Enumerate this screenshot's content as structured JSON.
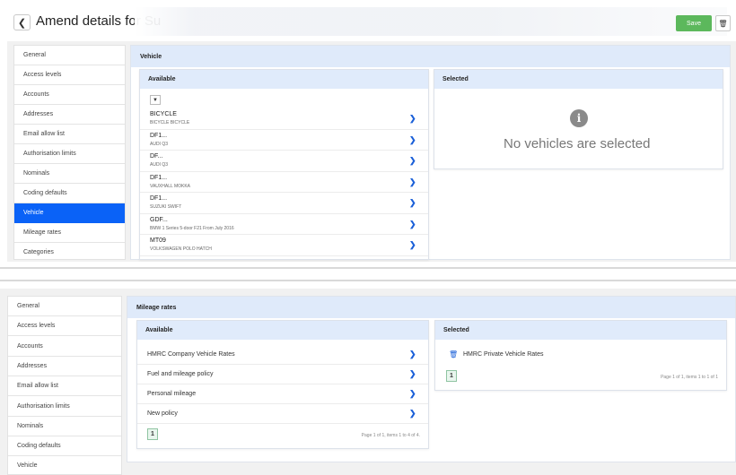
{
  "header": {
    "title": "Amend details for Su",
    "back_icon": "chevron-left-icon",
    "save_label": "Save",
    "delete_icon": "trash-icon"
  },
  "colors": {
    "active_nav": "#0a62f7",
    "save": "#5cb85c",
    "panel_header": "#dfeafa",
    "link": "#1a5fd8"
  },
  "upper": {
    "sidebar": [
      "General",
      "Access levels",
      "Accounts",
      "Addresses",
      "Email allow list",
      "Authorisation limits",
      "Nominals",
      "Coding defaults",
      "Vehicle",
      "Mileage rates",
      "Categories"
    ],
    "active_item": "Vehicle",
    "section_title": "Vehicle",
    "available_title": "Available",
    "filter_icon": "filter-icon",
    "vehicles": [
      {
        "reg": "BICYCLE",
        "desc": "BICYCLE BICYCLE"
      },
      {
        "reg": "DF1...",
        "desc": "AUDI Q3"
      },
      {
        "reg": "DF...",
        "desc": "AUDI Q3"
      },
      {
        "reg": "DF1...",
        "desc": "VAUXHALL MOKKA"
      },
      {
        "reg": "DF1...",
        "desc": "SUZUKI SWIFT"
      },
      {
        "reg": "GDF...",
        "desc": "BMW 1 Series 5-door F21 From July 2016"
      },
      {
        "reg": "MT09",
        "desc": "VOLKSWAGEN POLO HATCH"
      }
    ],
    "selected_title": "Selected",
    "empty_message": "No vehicles are selected",
    "info_icon_glyph": "i"
  },
  "lower": {
    "sidebar": [
      "General",
      "Access levels",
      "Accounts",
      "Addresses",
      "Email allow list",
      "Authorisation limits",
      "Nominals",
      "Coding defaults",
      "Vehicle"
    ],
    "section_title": "Mileage rates",
    "available_title": "Available",
    "available_rates": [
      "HMRC Company Vehicle Rates",
      "Fuel and mileage policy",
      "Personal mileage",
      "New policy"
    ],
    "available_page": "1",
    "available_page_info": "Page 1 of 1, items 1 to 4 of 4.",
    "selected_title": "Selected",
    "selected_rates": [
      "HMRC Private Vehicle Rates"
    ],
    "selected_page": "1",
    "selected_page_info": "Page 1 of 1, items 1 to 1 of 1"
  }
}
